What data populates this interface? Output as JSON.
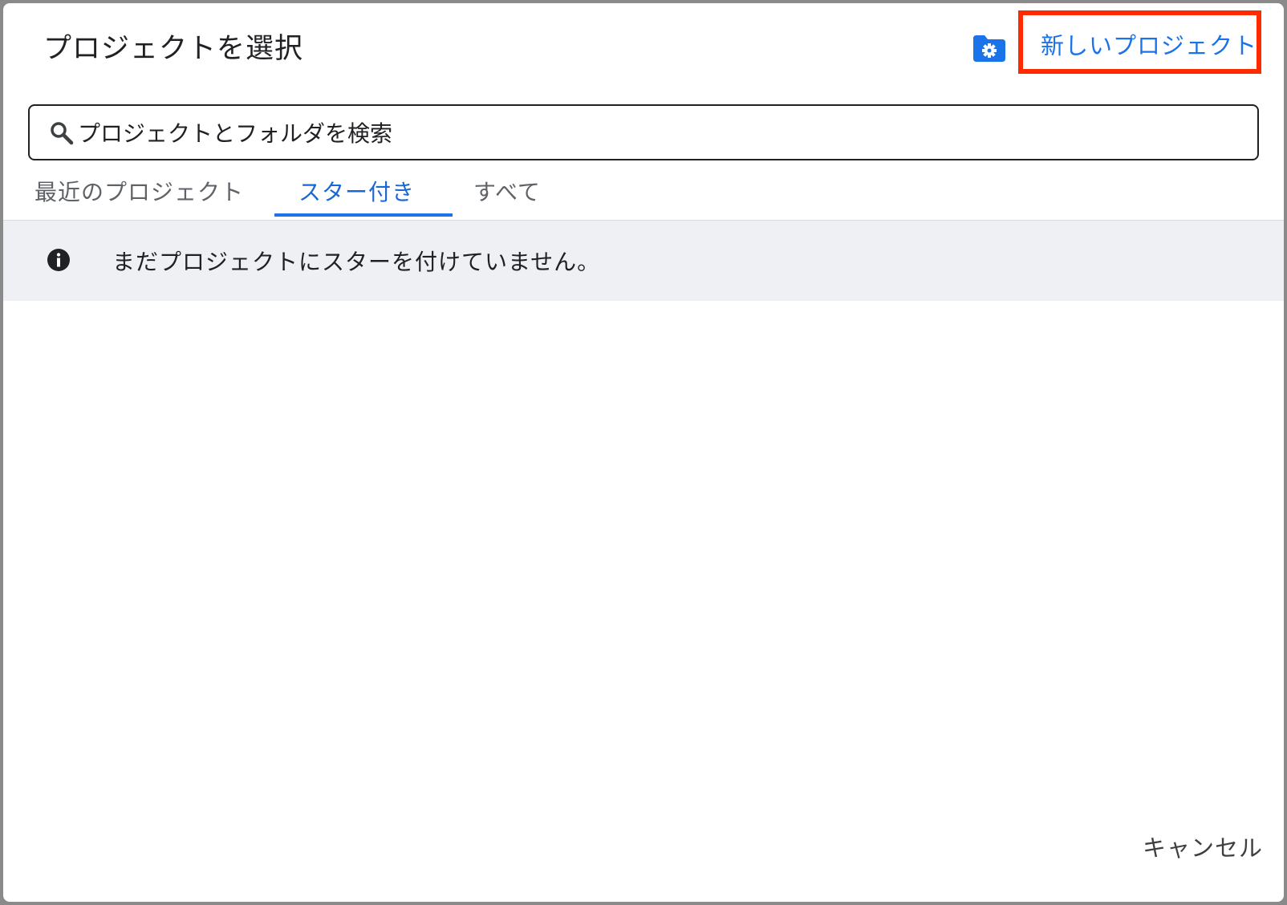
{
  "dialog": {
    "title": "プロジェクトを選択",
    "new_project_label": "新しいプロジェクト",
    "org_icon": "folder-settings-icon",
    "accent_color": "#1a73e8",
    "highlight_color": "#ff2a00"
  },
  "search": {
    "placeholder": "プロジェクトとフォルダを検索",
    "value": "",
    "icon": "search-icon"
  },
  "tabs": [
    {
      "label": "最近のプロジェクト",
      "active": false
    },
    {
      "label": "スター付き",
      "active": true
    },
    {
      "label": "すべて",
      "active": false
    }
  ],
  "info": {
    "icon": "info-icon",
    "message": "まだプロジェクトにスターを付けていません。"
  },
  "footer": {
    "cancel_label": "キャンセル"
  }
}
